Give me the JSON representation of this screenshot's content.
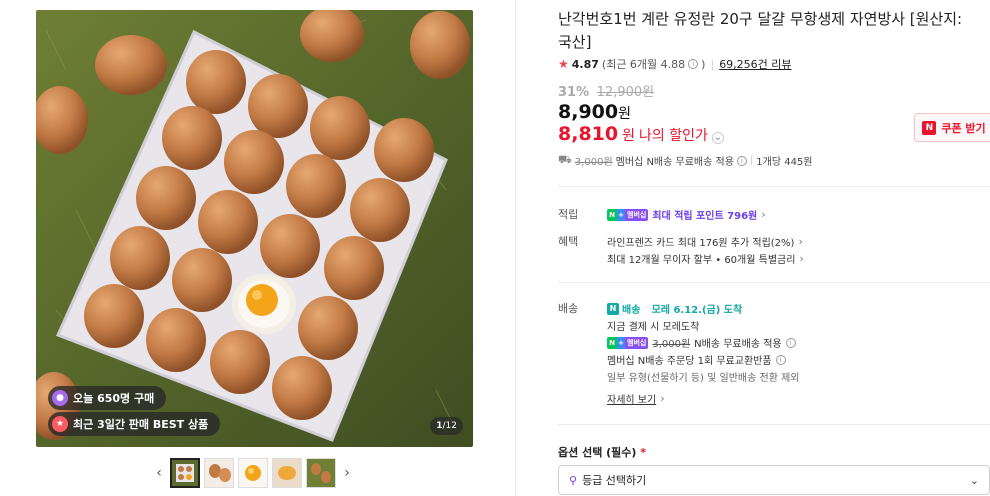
{
  "gallery": {
    "badge_buyers": "오늘 650명 구매",
    "badge_best": "최근 3일간 판매 BEST 상품",
    "counter_current": "1",
    "counter_total": "/12",
    "prev_arrow": "‹",
    "next_arrow": "›"
  },
  "product": {
    "title": "난각번호1번 계란 유정란 20구 달걀 무항생제 자연방사 [원산지: 국산]",
    "rating": "4.87",
    "recent_rating": "(최근 6개월 4.88",
    "review_count": "69,256건 리뷰",
    "discount_rate": "31%",
    "original_price": "12,900원",
    "price": "8,900",
    "price_unit": "원",
    "my_price": "8,810",
    "my_price_unit": "원",
    "my_price_label": "나의 할인가",
    "coupon_label": "쿠폰 받기",
    "ship_summary_strike": "3,000원",
    "ship_summary_text": "멤버십 N배송 무료배송 적용",
    "unit_price": "1개당 445원"
  },
  "benefits": {
    "point_label": "적립",
    "point_text": "최대 적립 포인트 796원",
    "benefit_label": "혜택",
    "benefit_line1": "라인프렌즈 카드 최대 176원 추가 적립(2%)",
    "benefit_line2": "최대 12개월 무이자 할부 • 60개월 특별금리"
  },
  "delivery": {
    "label": "배송",
    "nship_label": "배송",
    "eta": "모레 6.12.(금) 도착",
    "eta_sub": "지금 결제 시 모레도착",
    "free_strike": "3,000원",
    "free_text": "N배송 무료배송 적용",
    "exchange_text": "멤버십 N배송 주문당 1회 무료교환반품",
    "exclusion_text": "일부 유형(선물하기 등) 및 일반배송 전환 제외",
    "details_link": "자세히 보기"
  },
  "membership_badge": {
    "n": "N",
    "plus": "+",
    "label": "멤버십"
  },
  "options": {
    "label": "옵션 선택 (필수)",
    "required_mark": "*",
    "select_placeholder": "등급 선택하기"
  },
  "colors": {
    "accent_red": "#e8142b",
    "membership_purple": "#6a3ee6",
    "delivery_teal": "#16a7a7",
    "naver_green": "#03c75a"
  }
}
